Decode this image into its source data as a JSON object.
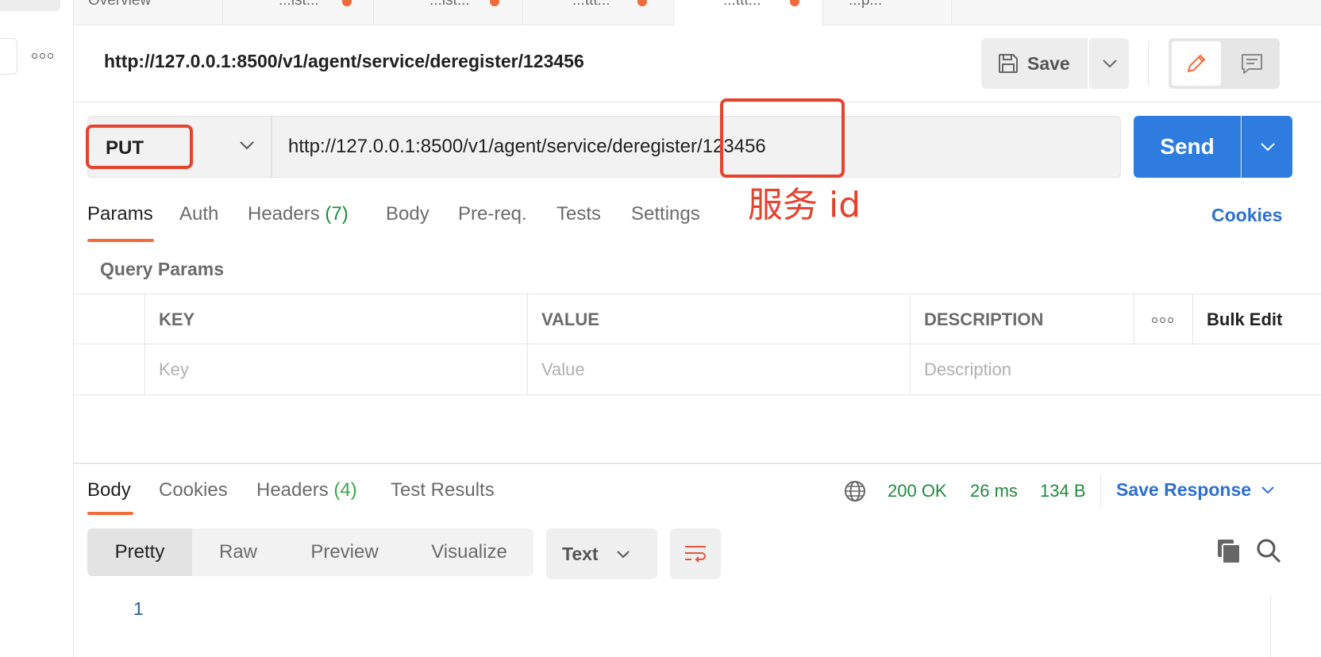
{
  "tabs": [
    {
      "label": "Overview"
    },
    {
      "label": "...ist..."
    },
    {
      "label": "...ist..."
    },
    {
      "label": "...ttt..."
    },
    {
      "label": "...ttt..."
    },
    {
      "label": "...p..."
    }
  ],
  "header": {
    "title": "http://127.0.0.1:8500/v1/agent/service/deregister/123456"
  },
  "toolbar": {
    "save_label": "Save"
  },
  "request": {
    "method": "PUT",
    "url": "http://127.0.0.1:8500/v1/agent/service/deregister/123456",
    "send_label": "Send"
  },
  "annotation": {
    "label": "服务 id"
  },
  "request_tabs": [
    {
      "label": "Params"
    },
    {
      "label": "Auth"
    },
    {
      "label": "Headers ",
      "count": "(7)"
    },
    {
      "label": "Body"
    },
    {
      "label": "Pre-req."
    },
    {
      "label": "Tests"
    },
    {
      "label": "Settings"
    }
  ],
  "cookies_label": "Cookies",
  "query_params": {
    "title": "Query Params",
    "columns": [
      "KEY",
      "VALUE",
      "DESCRIPTION"
    ],
    "bulk_edit": "Bulk Edit",
    "placeholders": {
      "key": "Key",
      "value": "Value",
      "description": "Description"
    }
  },
  "response_tabs": [
    {
      "label": "Body"
    },
    {
      "label": "Cookies"
    },
    {
      "label": "Headers ",
      "count": "(4)"
    },
    {
      "label": "Test Results"
    }
  ],
  "response_status": {
    "status": "200 OK",
    "time": "26 ms",
    "size": "134 B"
  },
  "save_response_label": "Save Response",
  "format_options": [
    "Pretty",
    "Raw",
    "Preview",
    "Visualize"
  ],
  "language": "Text",
  "line_number": "1",
  "colors": {
    "accent": "#f26b3a",
    "primary": "#2e7ce0",
    "annotation": "#e5432d",
    "success": "#1f8a3c"
  }
}
